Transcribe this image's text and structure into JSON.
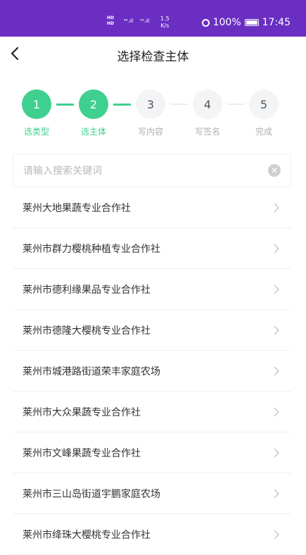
{
  "status_bar": {
    "hd_top": "HD",
    "hd_bottom": "HD",
    "signal1": "⁴⁶.ıll",
    "signal2": "⁵⁶.ıll",
    "speed_value": "1.5",
    "speed_unit": "K/s",
    "battery": "100%",
    "time": "17:45"
  },
  "header": {
    "title": "选择检查主体"
  },
  "steps": [
    {
      "number": "1",
      "label": "选类型",
      "state": "done"
    },
    {
      "number": "2",
      "label": "选主体",
      "state": "done"
    },
    {
      "number": "3",
      "label": "写内容",
      "state": "todo"
    },
    {
      "number": "4",
      "label": "写签名",
      "state": "todo"
    },
    {
      "number": "5",
      "label": "完成",
      "state": "todo"
    }
  ],
  "search": {
    "placeholder": "请输入搜索关键词",
    "value": ""
  },
  "list": [
    "莱州大地果蔬专业合作社",
    "莱州市群力樱桃种植专业合作社",
    "莱州市德利缘果品专业合作社",
    "莱州市德隆大樱桃专业合作社",
    "莱州市城港路街道荣丰家庭农场",
    "莱州市大众果蔬专业合作社",
    "莱州市文峰果蔬专业合作社",
    "莱州市三山岛街道宇鹏家庭农场",
    "莱州市绛珠大樱桃专业合作社"
  ],
  "colors": {
    "status_bar": "#6a2fc2",
    "accent_green": "#3fd08f",
    "inactive_step": "#f3f4f6"
  },
  "icons": {
    "back": "back-arrow-icon",
    "clear": "clear-icon",
    "chevron": "chevron-right-icon",
    "alarm": "alarm-icon",
    "battery": "battery-icon"
  }
}
